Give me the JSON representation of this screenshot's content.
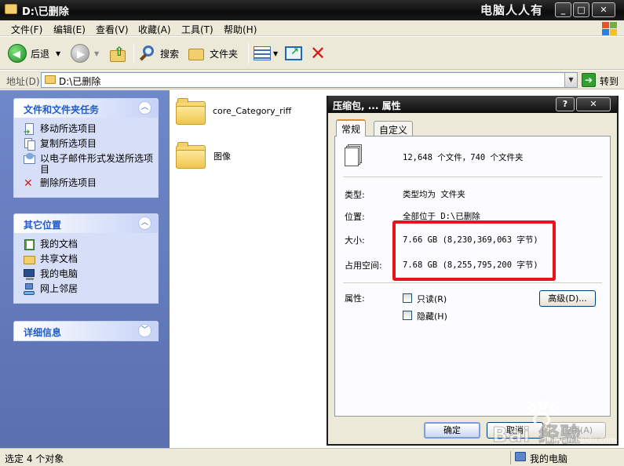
{
  "window": {
    "title": "D:\\已删除",
    "brand_watermark": "电脑人人有",
    "buttons": {
      "minimize": "_",
      "maximize": "□",
      "close": "✕"
    }
  },
  "menu": {
    "items": [
      "文件(F)",
      "编辑(E)",
      "查看(V)",
      "收藏(A)",
      "工具(T)",
      "帮助(H)"
    ]
  },
  "toolbar": {
    "back_label": "后退",
    "search_label": "搜索",
    "folders_label": "文件夹"
  },
  "address": {
    "label": "地址(D)",
    "value": "D:\\已删除",
    "go_label": "转到"
  },
  "sidebar": {
    "tasks": {
      "title": "文件和文件夹任务",
      "items": [
        "移动所选项目",
        "复制所选项目",
        "以电子邮件形式发送所选项目",
        "删除所选项目"
      ]
    },
    "places": {
      "title": "其它位置",
      "items": [
        "我的文档",
        "共享文档",
        "我的电脑",
        "网上邻居"
      ]
    },
    "details": {
      "title": "详细信息"
    }
  },
  "files": [
    {
      "name": "core_Category_riff"
    },
    {
      "name": "图像"
    }
  ],
  "dialog": {
    "title": "压缩包, ... 属性",
    "title_buttons": {
      "help": "?",
      "close": "✕"
    },
    "tabs": [
      "常规",
      "自定义"
    ],
    "summary": "12,648 个文件，740 个文件夹",
    "type_label": "类型:",
    "type_value": "类型均为 文件夹",
    "location_label": "位置:",
    "location_value": "全部位于 D:\\已删除",
    "size_label": "大小:",
    "size_value": "7.66 GB (8,230,369,063 字节)",
    "disk_label": "占用空间:",
    "disk_value": "7.68 GB (8,255,795,200 字节)",
    "attributes_label": "属性:",
    "readonly_label": "只读(R)",
    "hidden_label": "隐藏(H)",
    "advanced_label": "高级(D)...",
    "ok_label": "确定",
    "cancel_label": "取消",
    "apply_label": "应用(A)"
  },
  "status": {
    "selected": "选定 4 个对象",
    "location": "我的电脑"
  },
  "watermark": {
    "text": "Bai 经验",
    "sub": "jingyan.baidu.com"
  },
  "colors": {
    "highlight_box": "#e8141c",
    "sidebar_title": "#215dc6",
    "sidebar_bg": "#6f88c9"
  }
}
